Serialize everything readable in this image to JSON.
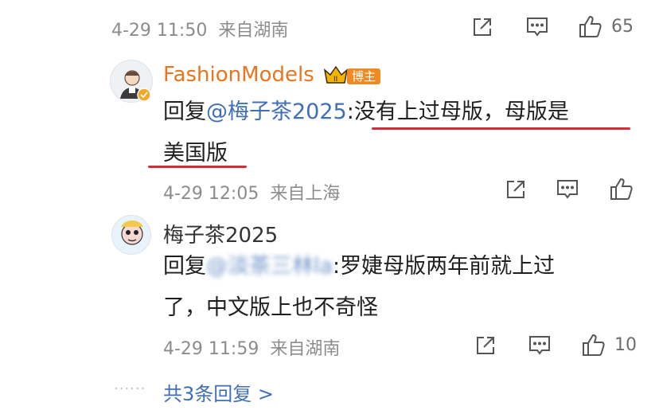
{
  "top_meta": {
    "time": "4-29 11:50",
    "source": "来自湖南",
    "like_count": "65"
  },
  "comment1": {
    "username": "FashionModels",
    "badge_label": "博主",
    "reply_prefix": "回复",
    "mention": "@梅子茶2025",
    "text_line1": ":没有上过母版，母版是",
    "text_line2": "美国版",
    "time": "4-29 12:05",
    "source": "来自上海",
    "colors": {
      "username": "#e9751f",
      "annotation": "#d32f3a"
    }
  },
  "comment2": {
    "username": "梅子茶2025",
    "reply_prefix": "回复",
    "mention": "@淡茶三林la",
    "text_line1": ":罗婕母版两年前就上过",
    "text_line2": "了，中文版上也不奇怪",
    "time": "4-29 11:59",
    "source": "来自湖南",
    "like_count": "10"
  },
  "footer": {
    "more_replies": "共3条回复 >",
    "dots": "······"
  },
  "icons": {
    "share": "share-icon",
    "comment": "comment-icon",
    "like": "thumb-up-icon",
    "verified": "verified-icon",
    "crown": "crown-icon"
  }
}
